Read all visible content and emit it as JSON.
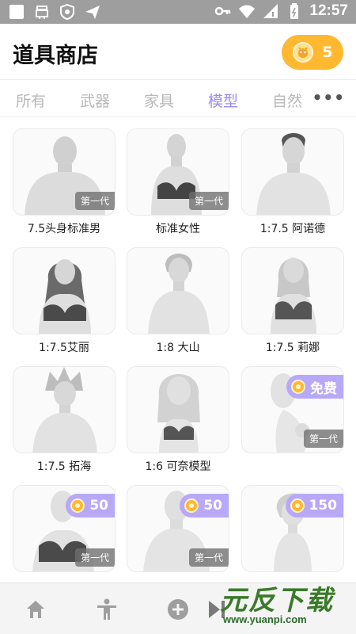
{
  "status_bar": {
    "time": "12:57",
    "icons": [
      "app-icon",
      "ghost-icon",
      "shield-icon",
      "send-icon",
      "key-icon",
      "wifi-icon",
      "signal-icon",
      "battery-icon"
    ]
  },
  "header": {
    "title": "道具商店",
    "coins": "5"
  },
  "tabs": [
    {
      "label": "所有"
    },
    {
      "label": "武器"
    },
    {
      "label": "家具"
    },
    {
      "label": "模型",
      "active": true
    },
    {
      "label": "自然"
    }
  ],
  "tab_more": "•••",
  "items": [
    {
      "label": "7.5头身标准男",
      "tag": "第一代"
    },
    {
      "label": "标准女性",
      "tag": "第一代"
    },
    {
      "label": "1:7.5 阿诺德"
    },
    {
      "label": "1:7.5艾丽"
    },
    {
      "label": "1:8 大山"
    },
    {
      "label": "1:7.5 莉娜"
    },
    {
      "label": "1:7.5 拓海"
    },
    {
      "label": "1:6 可奈模型"
    },
    {
      "label": "",
      "tag": "第一代",
      "price": "免费"
    },
    {
      "label": "",
      "tag": "第一代",
      "price": "50"
    },
    {
      "label": "",
      "tag": "第一代",
      "price": "50"
    },
    {
      "label": "",
      "price": "150"
    }
  ],
  "bottom_nav": [
    "home-icon",
    "pose-figure-icon",
    "add-icon",
    "next-icon"
  ],
  "watermark": {
    "main": "元反下载",
    "sub": "www.yuanpi.com"
  },
  "colors": {
    "accent": "#9b8cf2",
    "coin": "#ffb830",
    "price_pill": "#b7a9f7",
    "status_bar": "#9e9e9e"
  }
}
